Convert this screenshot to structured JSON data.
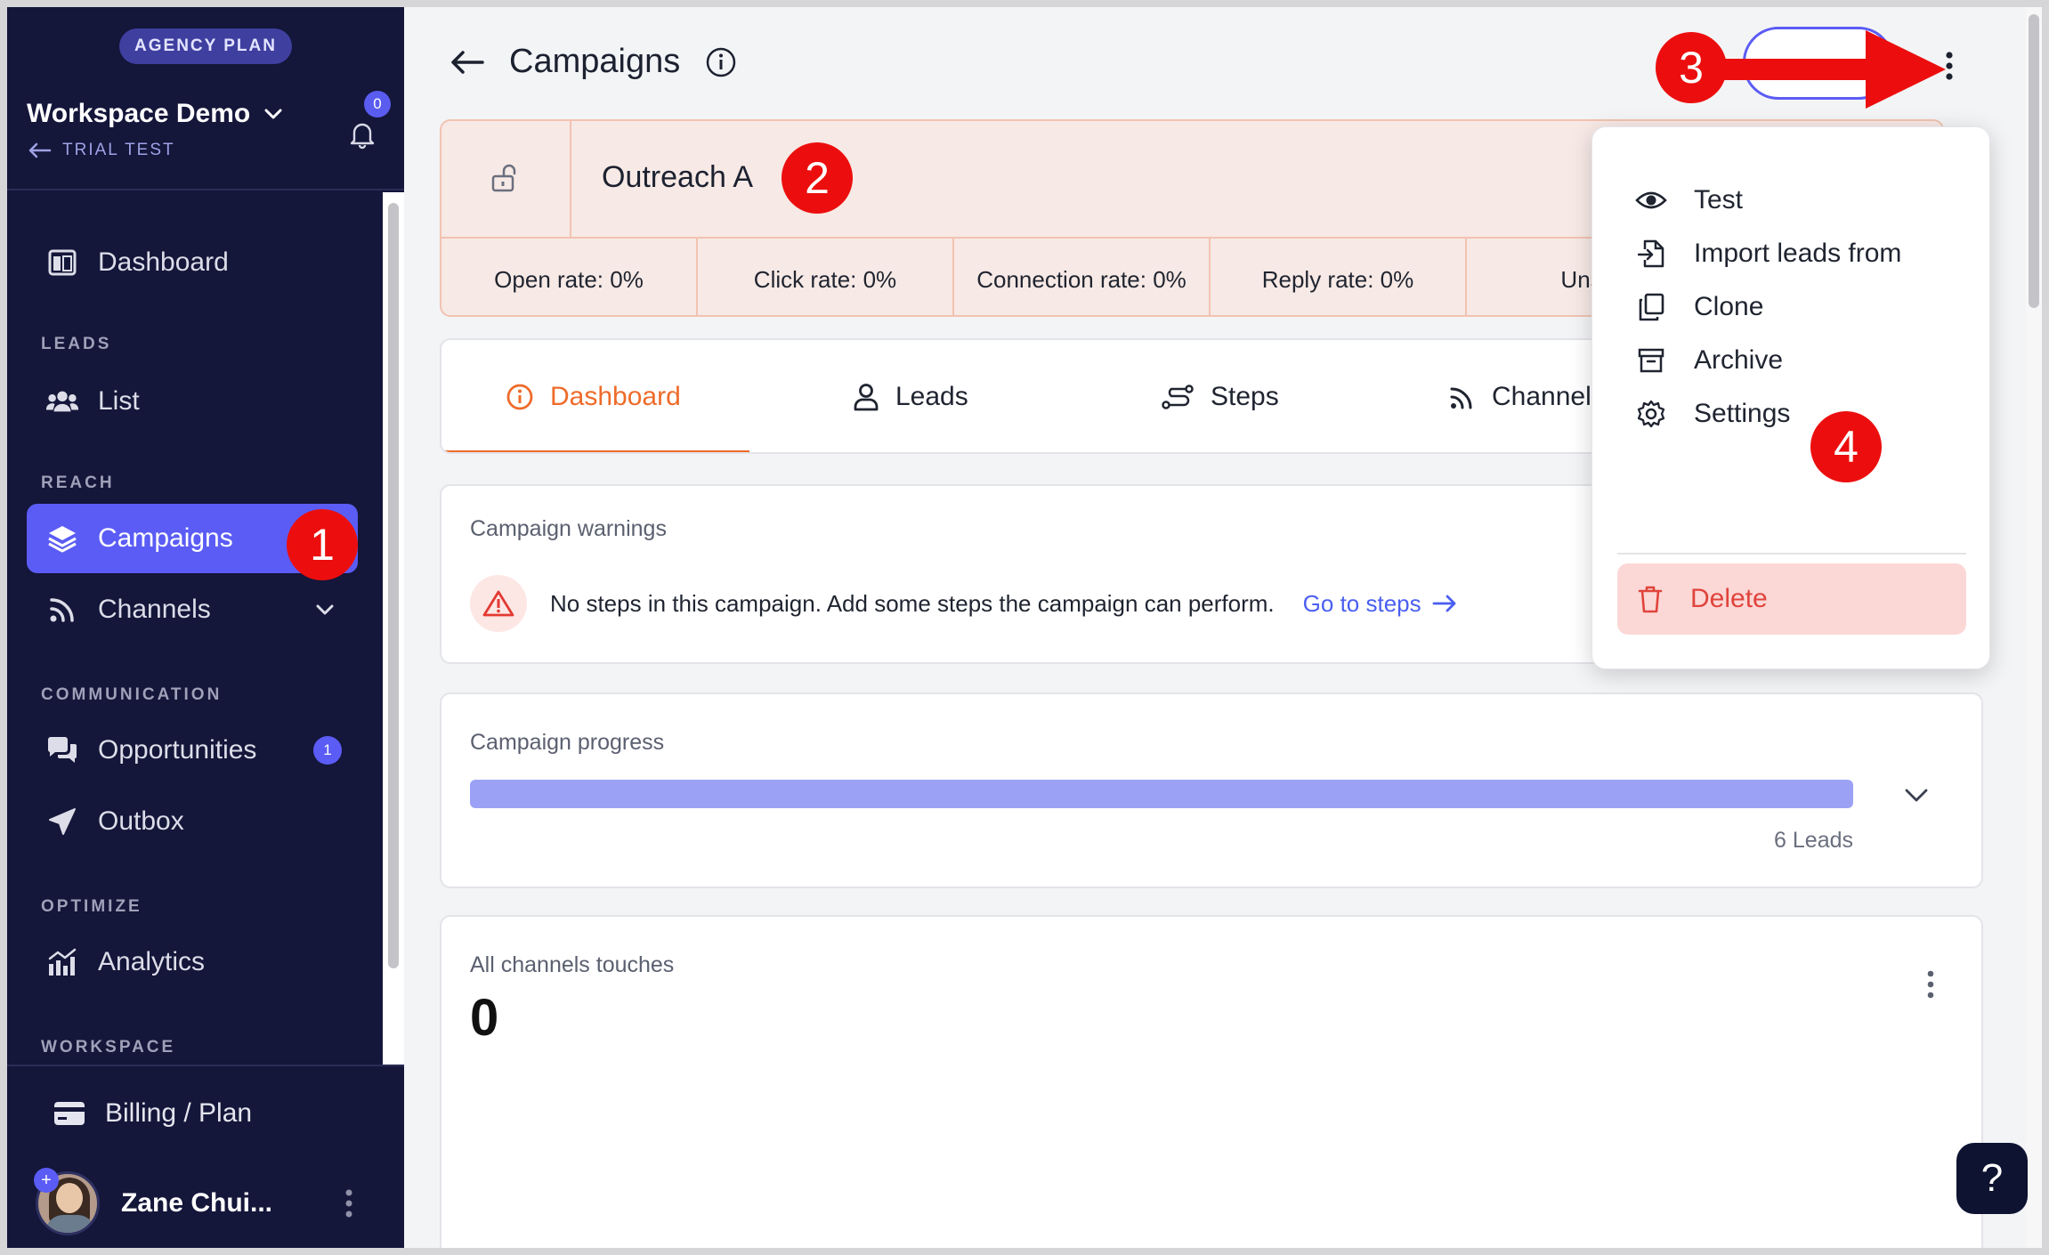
{
  "sidebar": {
    "plan_badge": "AGENCY PLAN",
    "workspace_name": "Workspace Demo",
    "workspace_sub": "TRIAL TEST",
    "notification_count": "0",
    "sections": {
      "leads": "LEADS",
      "reach": "REACH",
      "communication": "COMMUNICATION",
      "optimize": "OPTIMIZE",
      "workspace": "WORKSPACE"
    },
    "items": {
      "dashboard": "Dashboard",
      "list": "List",
      "campaigns": "Campaigns",
      "channels": "Channels",
      "opportunities": "Opportunities",
      "opportunities_badge": "1",
      "outbox": "Outbox",
      "analytics": "Analytics"
    },
    "billing": "Billing / Plan",
    "user_name": "Zane Chui...",
    "avatar_plus": "+"
  },
  "header": {
    "title": "Campaigns"
  },
  "campaign": {
    "name": "Outreach A",
    "stats": [
      "Open rate: 0%",
      "Click rate: 0%",
      "Connection rate: 0%",
      "Reply rate: 0%",
      "Unsub"
    ]
  },
  "tabs": [
    "Dashboard",
    "Leads",
    "Steps",
    "Channel"
  ],
  "warnings": {
    "title": "Campaign warnings",
    "message": "No steps in this campaign. Add some steps the campaign can perform.",
    "link": "Go to steps"
  },
  "progress": {
    "title": "Campaign progress",
    "fill_percent": 100,
    "leads": "6 Leads"
  },
  "touches": {
    "title": "All channels touches",
    "value": "0"
  },
  "menu": {
    "items": [
      "Test",
      "Import leads from",
      "Clone",
      "Archive",
      "Settings"
    ],
    "delete": "Delete"
  },
  "help": "?",
  "annotations": [
    "1",
    "2",
    "3",
    "4"
  ],
  "colors": {
    "sidebar_bg": "#14163a",
    "accent": "#5b5cf5",
    "tab_active": "#ee6b2a",
    "campaign_card_bg": "#f7e9e5",
    "delete_bg": "#fbd8d6",
    "delete_text": "#e0443c",
    "annotation_red": "#ec0e0e"
  }
}
